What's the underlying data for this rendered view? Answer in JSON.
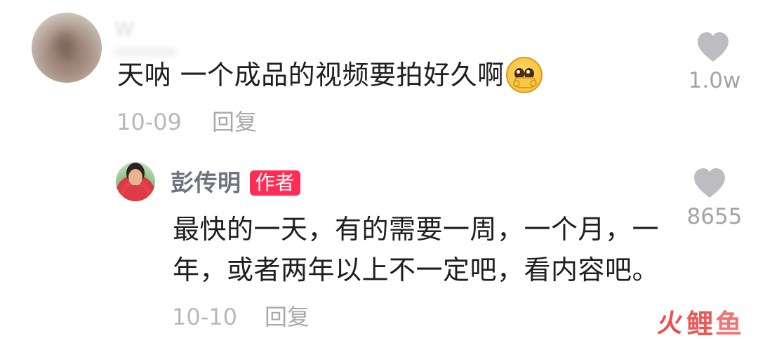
{
  "comment": {
    "username": "W",
    "text": "天呐 一个成品的视频要拍好久啊",
    "emoji": "pleading-face-with-hands-emoji",
    "date": "10-09",
    "reply_label": "回复",
    "likes": "1.0w"
  },
  "reply": {
    "username": "彭传明",
    "badge": "作者",
    "text": "最快的一天，有的需要一周，一个月，一年，或者两年以上不一定吧，看内容吧。",
    "date": "10-10",
    "reply_label": "回复",
    "likes": "8655"
  },
  "watermark": {
    "part1": "火",
    "part2": "鲤",
    "part3": "鱼"
  },
  "icons": {
    "heart": "heart-icon",
    "main_avatar": "user-avatar",
    "reply_avatar": "author-avatar"
  },
  "colors": {
    "text": "#1f1f1f",
    "meta": "#b8b8bc",
    "name": "#6f7380",
    "badge": "#ff2d55",
    "heart": "#bdbdc1",
    "watermark": "#ef4d4d"
  }
}
